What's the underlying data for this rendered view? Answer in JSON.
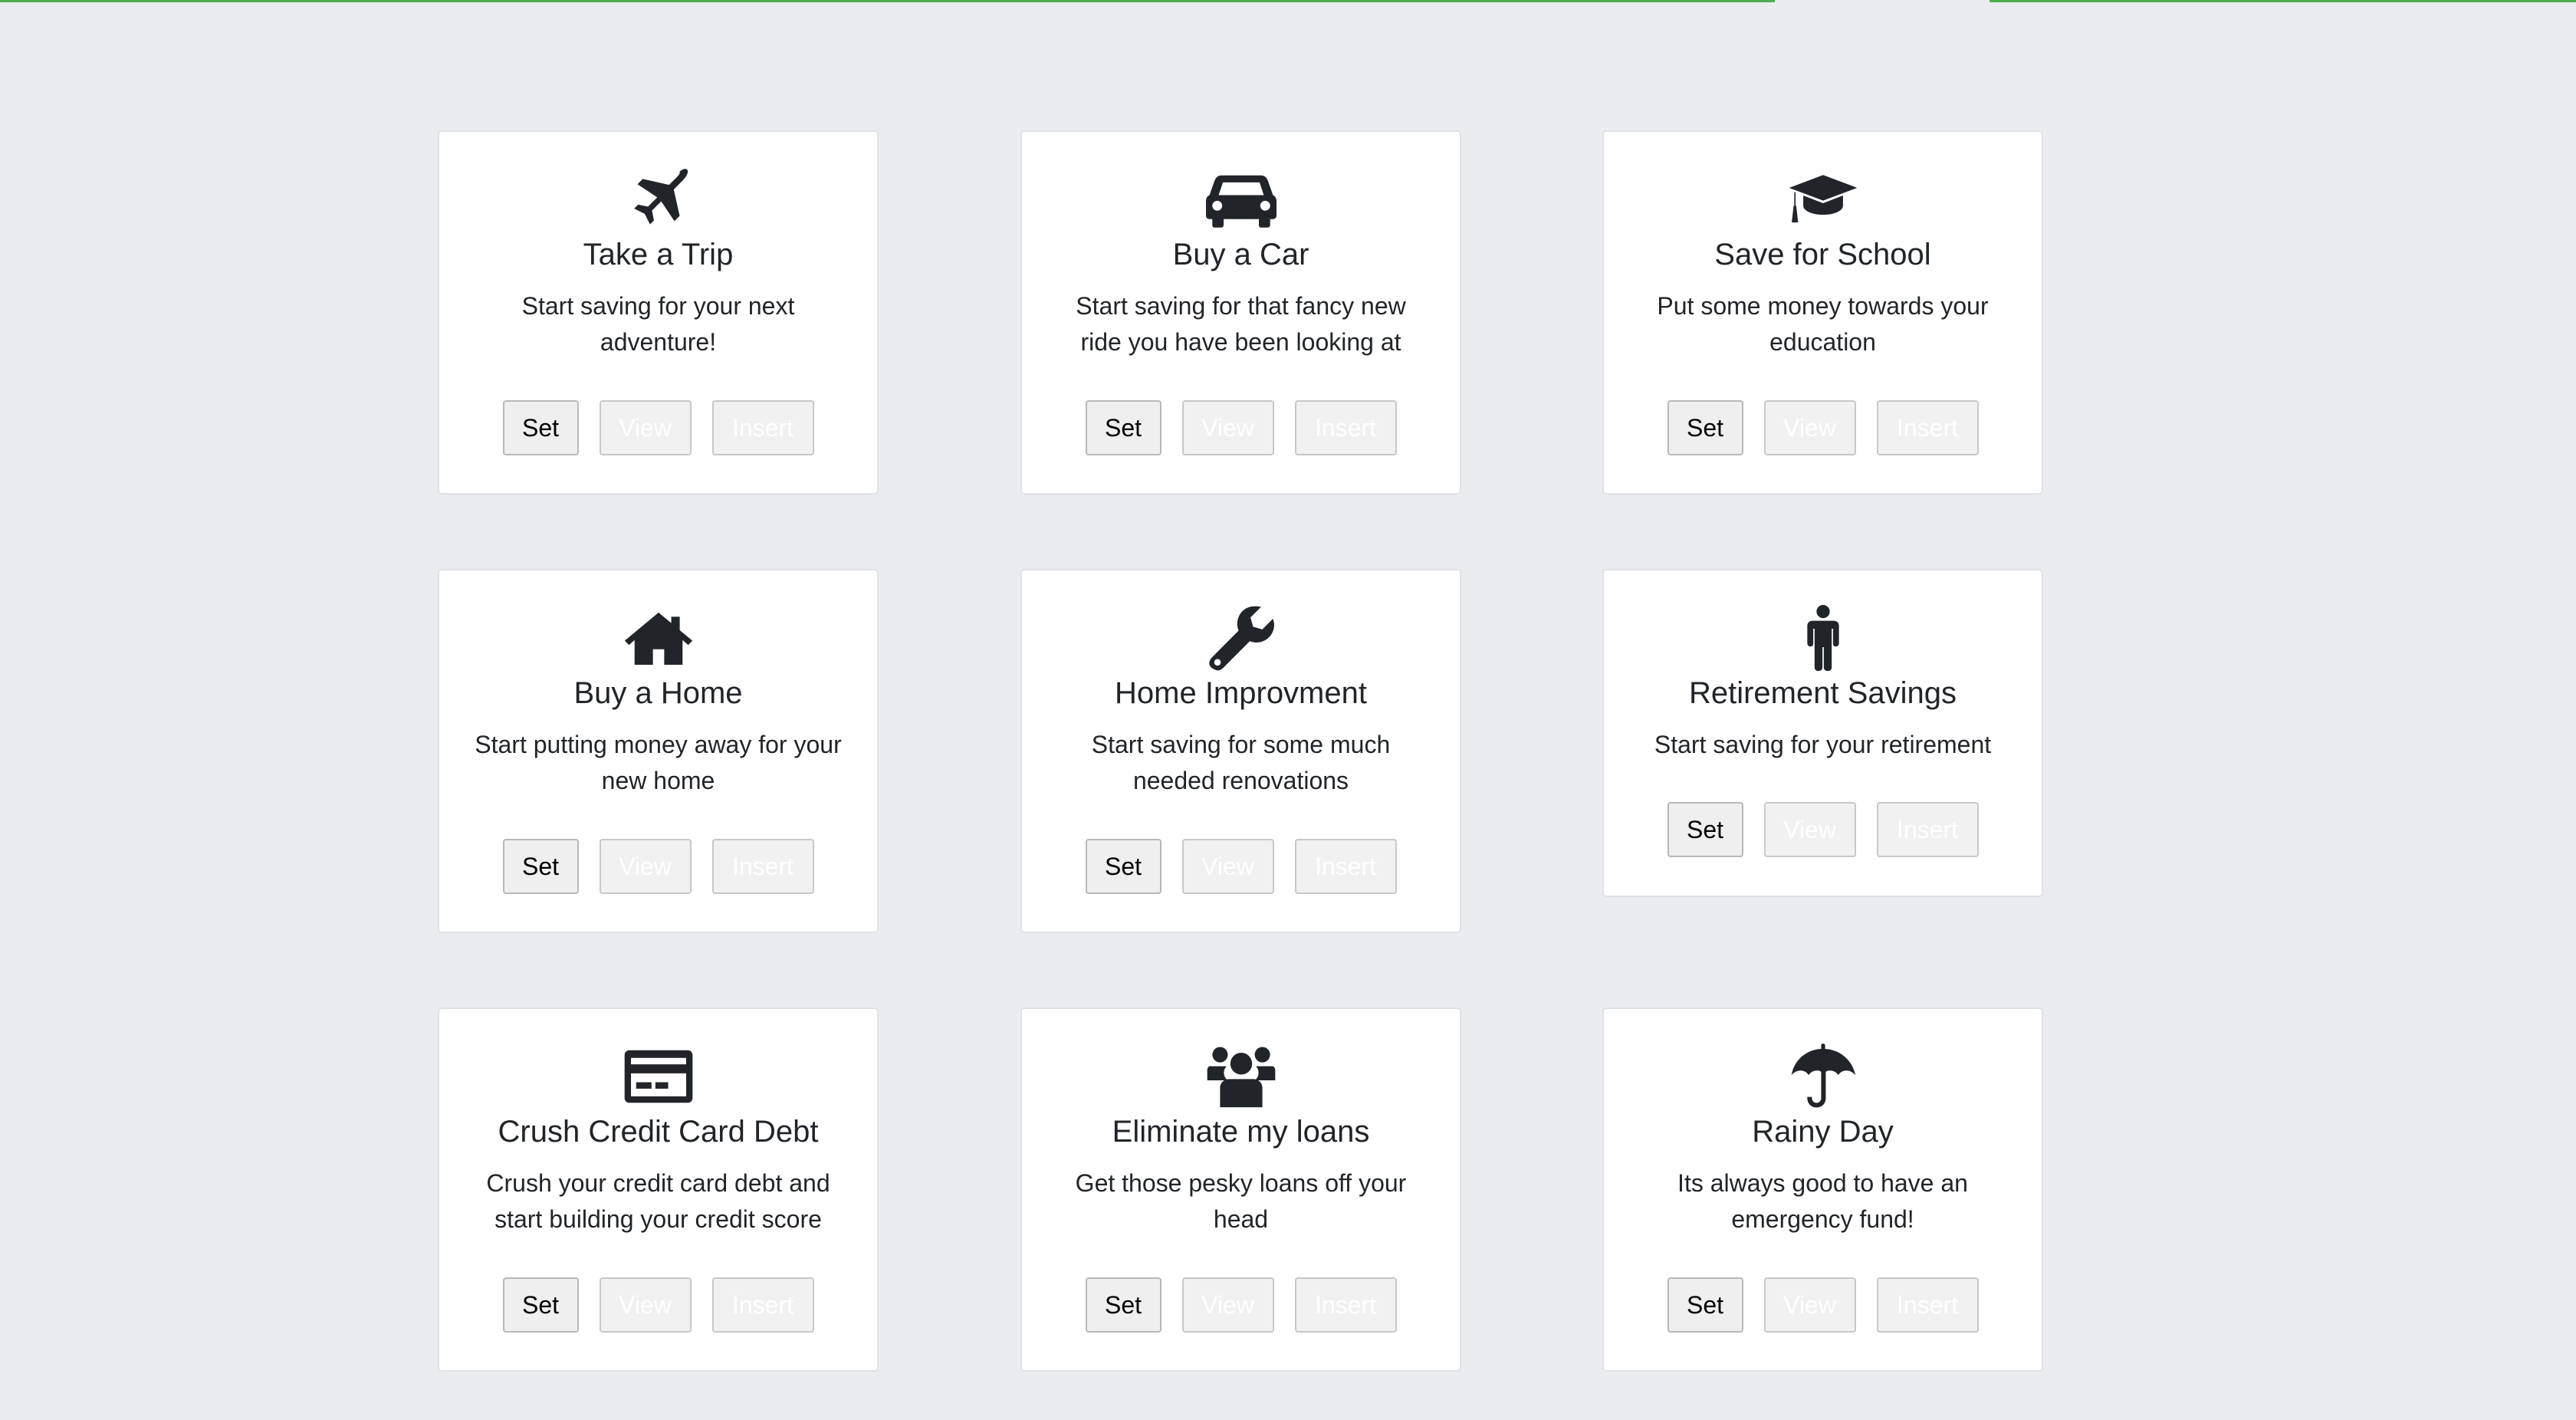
{
  "colors": {
    "page_background": "#ebecf0",
    "top_line": "#4caf50",
    "card_background": "#ffffff",
    "icon": "#212529"
  },
  "goals": [
    {
      "icon": "plane-icon",
      "title": "Take a Trip",
      "description": "Start saving for your next adventure!",
      "buttons": {
        "set": "Set",
        "view": "View",
        "insert": "Insert"
      }
    },
    {
      "icon": "car-icon",
      "title": "Buy a Car",
      "description": "Start saving for that fancy new ride you have been looking at",
      "buttons": {
        "set": "Set",
        "view": "View",
        "insert": "Insert"
      }
    },
    {
      "icon": "graduation-cap-icon",
      "title": "Save for School",
      "description": "Put some money towards your education",
      "buttons": {
        "set": "Set",
        "view": "View",
        "insert": "Insert"
      }
    },
    {
      "icon": "home-icon",
      "title": "Buy a Home",
      "description": "Start putting money away for your new home",
      "buttons": {
        "set": "Set",
        "view": "View",
        "insert": "Insert"
      }
    },
    {
      "icon": "wrench-icon",
      "title": "Home Improvment",
      "description": "Start saving for some much needed renovations",
      "buttons": {
        "set": "Set",
        "view": "View",
        "insert": "Insert"
      }
    },
    {
      "icon": "person-icon",
      "title": "Retirement Savings",
      "description": "Start saving for your retirement",
      "buttons": {
        "set": "Set",
        "view": "View",
        "insert": "Insert"
      }
    },
    {
      "icon": "credit-card-icon",
      "title": "Crush Credit Card Debt",
      "description": "Crush your credit card debt and start building your credit score",
      "buttons": {
        "set": "Set",
        "view": "View",
        "insert": "Insert"
      }
    },
    {
      "icon": "users-icon",
      "title": "Eliminate my loans",
      "description": "Get those pesky loans off your head",
      "buttons": {
        "set": "Set",
        "view": "View",
        "insert": "Insert"
      }
    },
    {
      "icon": "umbrella-icon",
      "title": "Rainy Day",
      "description": "Its always good to have an emergency fund!",
      "buttons": {
        "set": "Set",
        "view": "View",
        "insert": "Insert"
      }
    }
  ]
}
